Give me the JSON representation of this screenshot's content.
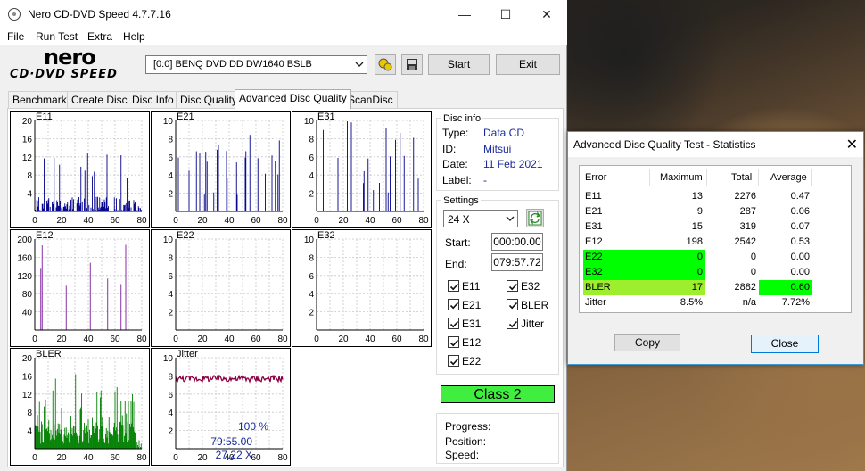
{
  "window": {
    "title": "Nero CD-DVD Speed 4.7.7.16",
    "minimize": "—",
    "maximize": "☐",
    "close": "✕"
  },
  "menu": [
    "File",
    "Run Test",
    "Extra",
    "Help"
  ],
  "logo": {
    "line1": "nero",
    "line2": "CD·DVD SPEED"
  },
  "drive": {
    "value": "[0:0]   BENQ DVD DD DW1640 BSLB"
  },
  "buttons": {
    "start": "Start",
    "exit": "Exit"
  },
  "tabs": [
    "Benchmark",
    "Create Disc",
    "Disc Info",
    "Disc Quality",
    "Advanced Disc Quality",
    "ScanDisc"
  ],
  "active_tab": 4,
  "disc_info": {
    "group": "Disc info",
    "type_label": "Type:",
    "type": "Data CD",
    "id_label": "ID:",
    "id": "Mitsui",
    "date_label": "Date:",
    "date": "11 Feb 2021",
    "label_label": "Label:",
    "label": "-"
  },
  "settings": {
    "group": "Settings",
    "speed": "24 X",
    "start_label": "Start:",
    "start": "000:00.00",
    "end_label": "End:",
    "end": "079:57.72",
    "checks": [
      {
        "label": "E11",
        "checked": true
      },
      {
        "label": "E32",
        "checked": true
      },
      {
        "label": "E21",
        "checked": true
      },
      {
        "label": "BLER",
        "checked": true
      },
      {
        "label": "E31",
        "checked": true
      },
      {
        "label": "Jitter",
        "checked": true
      },
      {
        "label": "E12",
        "checked": true
      },
      {
        "label": "E22",
        "checked": true
      }
    ]
  },
  "class": "Class 2",
  "progress": {
    "progress_label": "Progress:",
    "progress": "100 %",
    "position_label": "Position:",
    "position": "79:55.00",
    "speed_label": "Speed:",
    "speed": "27.22 X"
  },
  "stats": {
    "title": "Advanced Disc Quality Test - Statistics",
    "close": "✕",
    "headers": [
      "Error",
      "Maximum",
      "Total",
      "Average"
    ],
    "rows": [
      {
        "error": "E11",
        "maximum": "13",
        "total": "2276",
        "average": "0.47",
        "hl_max": "",
        "hl_avg": ""
      },
      {
        "error": "E21",
        "maximum": "9",
        "total": "287",
        "average": "0.06",
        "hl_max": "",
        "hl_avg": ""
      },
      {
        "error": "E31",
        "maximum": "15",
        "total": "319",
        "average": "0.07",
        "hl_max": "",
        "hl_avg": ""
      },
      {
        "error": "E12",
        "maximum": "198",
        "total": "2542",
        "average": "0.53",
        "hl_max": "",
        "hl_avg": ""
      },
      {
        "error": "E22",
        "maximum": "0",
        "total": "0",
        "average": "0.00",
        "hl_max": "#00ff00",
        "hl_avg": ""
      },
      {
        "error": "E32",
        "maximum": "0",
        "total": "0",
        "average": "0.00",
        "hl_max": "#00ff00",
        "hl_avg": ""
      },
      {
        "error": "BLER",
        "maximum": "17",
        "total": "2882",
        "average": "0.60",
        "hl_max": "#9dee2c",
        "hl_avg": "#00ff00"
      },
      {
        "error": "Jitter",
        "maximum": "8.5%",
        "total": "n/a",
        "average": "7.72%",
        "hl_max": "",
        "hl_avg": ""
      }
    ],
    "copy": "Copy",
    "close_btn": "Close"
  },
  "colors": {
    "bar_blue": "#00008b",
    "bar_purple": "#7a1a9a",
    "bar_green": "#008000",
    "jitter_line": "#8b0040",
    "class_green": "#3fee3f"
  },
  "chart_data": [
    {
      "type": "bar",
      "title": "E11",
      "x": [
        0,
        80
      ],
      "xticks": [
        0,
        20,
        40,
        60,
        80
      ],
      "yticks": [
        4,
        8,
        12,
        16,
        20
      ],
      "ylim": [
        0,
        20
      ],
      "color": "#00008b",
      "series_profile": "dense-low",
      "max": 13
    },
    {
      "type": "bar",
      "title": "E21",
      "x": [
        0,
        80
      ],
      "xticks": [
        0,
        20,
        40,
        60,
        80
      ],
      "yticks": [
        2,
        4,
        6,
        8,
        10
      ],
      "ylim": [
        0,
        10
      ],
      "color": "#00008b",
      "series_profile": "sparse-spikes",
      "max": 9
    },
    {
      "type": "bar",
      "title": "E31",
      "x": [
        0,
        80
      ],
      "xticks": [
        0,
        20,
        40,
        60,
        80
      ],
      "yticks": [
        2,
        4,
        6,
        8,
        10
      ],
      "ylim": [
        0,
        10
      ],
      "color": "#00008b",
      "series_profile": "sparse-spikes",
      "max": 15
    },
    {
      "type": "bar",
      "title": "E12",
      "x": [
        0,
        80
      ],
      "xticks": [
        0,
        20,
        40,
        60,
        80
      ],
      "yticks": [
        40,
        80,
        120,
        160,
        200
      ],
      "ylim": [
        0,
        200
      ],
      "color": "#7a1a9a",
      "series_profile": "sparse-spikes",
      "max": 198
    },
    {
      "type": "bar",
      "title": "E22",
      "x": [
        0,
        80
      ],
      "xticks": [
        0,
        20,
        40,
        60,
        80
      ],
      "yticks": [
        2,
        4,
        6,
        8,
        10
      ],
      "ylim": [
        0,
        10
      ],
      "color": "#00008b",
      "series_profile": "empty",
      "max": 0
    },
    {
      "type": "bar",
      "title": "E32",
      "x": [
        0,
        80
      ],
      "xticks": [
        0,
        20,
        40,
        60,
        80
      ],
      "yticks": [
        2,
        4,
        6,
        8,
        10
      ],
      "ylim": [
        0,
        10
      ],
      "color": "#00008b",
      "series_profile": "empty",
      "max": 0
    },
    {
      "type": "bar",
      "title": "BLER",
      "x": [
        0,
        80
      ],
      "xticks": [
        0,
        20,
        40,
        60,
        80
      ],
      "yticks": [
        4,
        8,
        12,
        16,
        20
      ],
      "ylim": [
        0,
        20
      ],
      "color": "#008000",
      "series_profile": "dense-mid",
      "max": 17
    },
    {
      "type": "line",
      "title": "Jitter",
      "x": [
        0,
        80
      ],
      "xticks": [
        0,
        20,
        40,
        60,
        80
      ],
      "yticks": [
        2,
        4,
        6,
        8,
        10
      ],
      "ylim": [
        0,
        10
      ],
      "color": "#8b0040",
      "series_profile": "flat-8",
      "max": 8.5
    }
  ]
}
